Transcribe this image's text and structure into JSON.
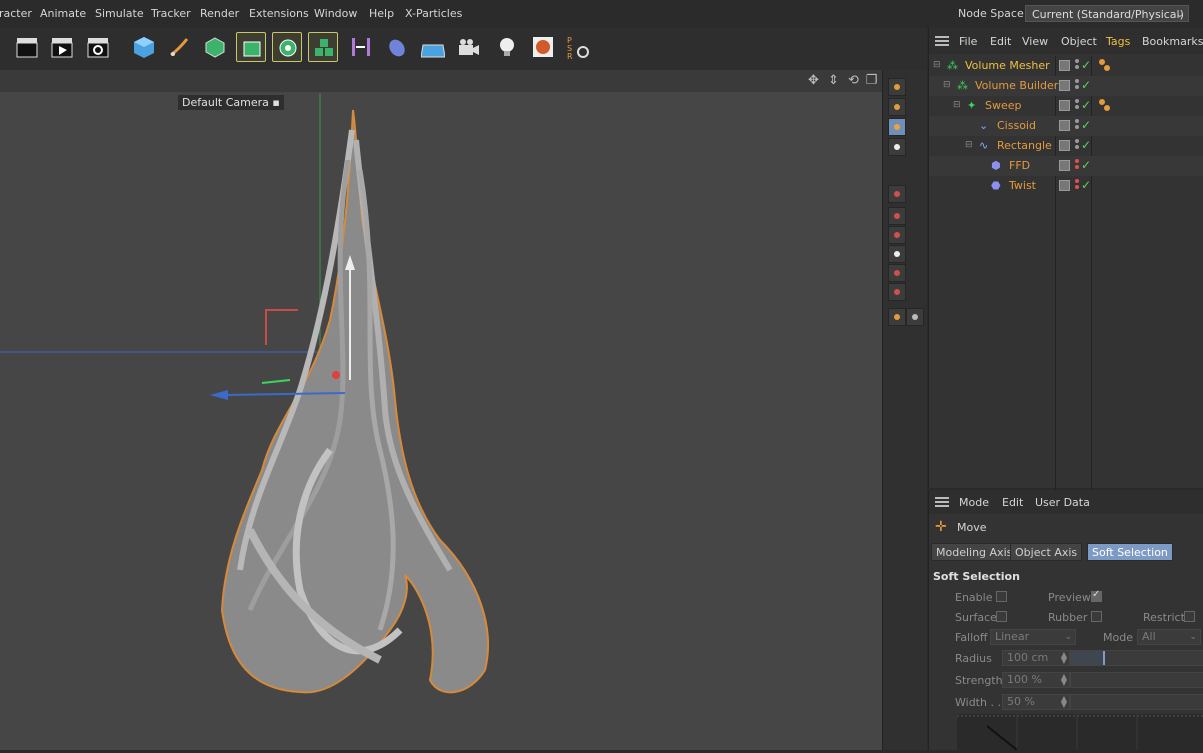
{
  "menubar": {
    "items": [
      "racter",
      "Animate",
      "Simulate",
      "Tracker",
      "Render",
      "Extensions",
      "Window",
      "Help",
      "X-Particles"
    ],
    "node_space_label": "Node Space:",
    "node_space_value": "Current (Standard/Physical)"
  },
  "toolbar": {
    "buttons": [
      "render-view",
      "render-picture-viewer",
      "render-settings",
      "cube",
      "pen",
      "subdivision-surface",
      "extrude",
      "cloner",
      "volume-builder",
      "symmetry",
      "deformer",
      "floor",
      "camera",
      "light",
      "material",
      "psr-reset"
    ]
  },
  "viewport": {
    "camera_label": "Default Camera",
    "camera_icon": "camera-icon"
  },
  "object_manager": {
    "menu": [
      "File",
      "Edit",
      "View",
      "Object",
      "Tags",
      "Bookmarks"
    ],
    "objects": [
      {
        "name": "Volume Mesher",
        "depth": 0,
        "tag": true
      },
      {
        "name": "Volume Builder",
        "depth": 1,
        "tag": false
      },
      {
        "name": "Sweep",
        "depth": 2,
        "tag": true
      },
      {
        "name": "Cissoid",
        "depth": 3,
        "tag": false
      },
      {
        "name": "Rectangle",
        "depth": 3,
        "tag": false
      },
      {
        "name": "FFD",
        "depth": 4,
        "tag": false
      },
      {
        "name": "Twist",
        "depth": 4,
        "tag": false
      }
    ]
  },
  "attribute_manager": {
    "menu": [
      "Mode",
      "Edit",
      "User Data"
    ],
    "tool_name": "Move",
    "tabs": [
      "Modeling Axis",
      "Object Axis",
      "Soft Selection"
    ],
    "active_tab": "Soft Selection",
    "section_title": "Soft Selection",
    "enable_label": "Enable",
    "preview_label": "Preview",
    "surface_label": "Surface",
    "rubber_label": "Rubber",
    "restrict_label": "Restrict",
    "falloff_label": "Falloff",
    "falloff_value": "Linear",
    "mode_label": "Mode",
    "mode_value": "All",
    "radius_label": "Radius",
    "radius_value": "100 cm",
    "strength_label": "Strength",
    "strength_value": "100 %",
    "width_label": "Width . .",
    "width_value": "50 %",
    "radius_slider_fraction": 0.24
  },
  "colors": {
    "object_name": "#e59a3c",
    "selected_object": "#f0c040",
    "active_tab": "#7d9ac4",
    "check": "#5fd55f"
  }
}
